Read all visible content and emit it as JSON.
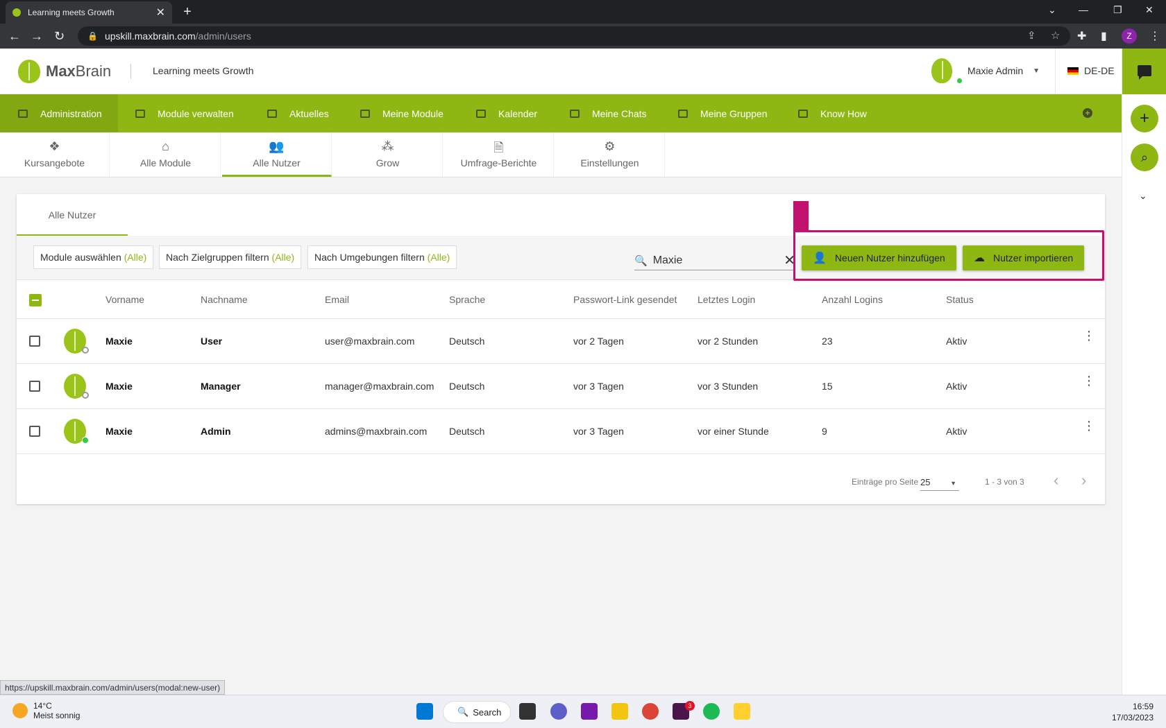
{
  "browser": {
    "tab_title": "Learning meets Growth",
    "url_host": "upskill.maxbrain.com",
    "url_path": "/admin/users",
    "profile_initial": "Z"
  },
  "header": {
    "logo_bold": "Max",
    "logo_light": "Brain",
    "tagline": "Learning meets Growth",
    "user_name": "Maxie Admin",
    "language": "DE-DE"
  },
  "main_nav": [
    {
      "label": "Administration",
      "icon": "admin-icon"
    },
    {
      "label": "Module verwalten",
      "icon": "folder-icon"
    },
    {
      "label": "Aktuelles",
      "icon": "news-icon"
    },
    {
      "label": "Meine Module",
      "icon": "graduation-cap-icon"
    },
    {
      "label": "Kalender",
      "icon": "calendar-icon"
    },
    {
      "label": "Meine Chats",
      "icon": "chat-icon"
    },
    {
      "label": "Meine Gruppen",
      "icon": "group-folder-icon"
    },
    {
      "label": "Know How",
      "icon": "book-icon"
    }
  ],
  "sub_tabs": [
    {
      "label": "Kursangebote",
      "icon": "course-offer-icon"
    },
    {
      "label": "Alle Module",
      "icon": "institution-icon"
    },
    {
      "label": "Alle Nutzer",
      "icon": "users-icon"
    },
    {
      "label": "Grow",
      "icon": "group-icon"
    },
    {
      "label": "Umfrage-Berichte",
      "icon": "report-icon"
    },
    {
      "label": "Einstellungen",
      "icon": "gears-icon"
    }
  ],
  "card": {
    "tab_label": "Alle Nutzer",
    "filters": [
      {
        "label": "Module auswählen",
        "suffix": "(Alle)"
      },
      {
        "label": "Nach Zielgruppen filtern",
        "suffix": "(Alle)"
      },
      {
        "label": "Nach Umgebungen filtern",
        "suffix": "(Alle)"
      }
    ],
    "search_value": "Maxie",
    "add_user_label": "Neuen Nutzer hinzufügen",
    "import_label": "Nutzer importieren"
  },
  "table": {
    "columns": [
      "Vorname",
      "Nachname",
      "Email",
      "Sprache",
      "Passwort-Link gesendet",
      "Letztes Login",
      "Anzahl Logins",
      "Status"
    ],
    "rows": [
      {
        "first": "Maxie",
        "last": "User",
        "email": "user@maxbrain.com",
        "lang": "Deutsch",
        "pw": "vor 2 Tagen",
        "login": "vor 2 Stunden",
        "count": "23",
        "status": "Aktiv"
      },
      {
        "first": "Maxie",
        "last": "Manager",
        "email": "manager@maxbrain.com",
        "lang": "Deutsch",
        "pw": "vor 3 Tagen",
        "login": "vor 3 Stunden",
        "count": "15",
        "status": "Aktiv"
      },
      {
        "first": "Maxie",
        "last": "Admin",
        "email": "admins@maxbrain.com",
        "lang": "Deutsch",
        "pw": "vor 3 Tagen",
        "login": "vor einer Stunde",
        "count": "9",
        "status": "Aktiv"
      }
    ]
  },
  "pagination": {
    "per_page_label": "Einträge pro Seite",
    "per_page_value": "25",
    "range": "1 - 3 von 3"
  },
  "status_url": "https://upskill.maxbrain.com/admin/users(modal:new-user)",
  "taskbar": {
    "temperature": "14°C",
    "weather": "Meist sonnig",
    "search_label": "Search",
    "slack_badge": "3",
    "time": "16:59",
    "date": "17/03/2023"
  },
  "colors": {
    "brand_green": "#8fb714",
    "highlight": "#c2116e"
  }
}
